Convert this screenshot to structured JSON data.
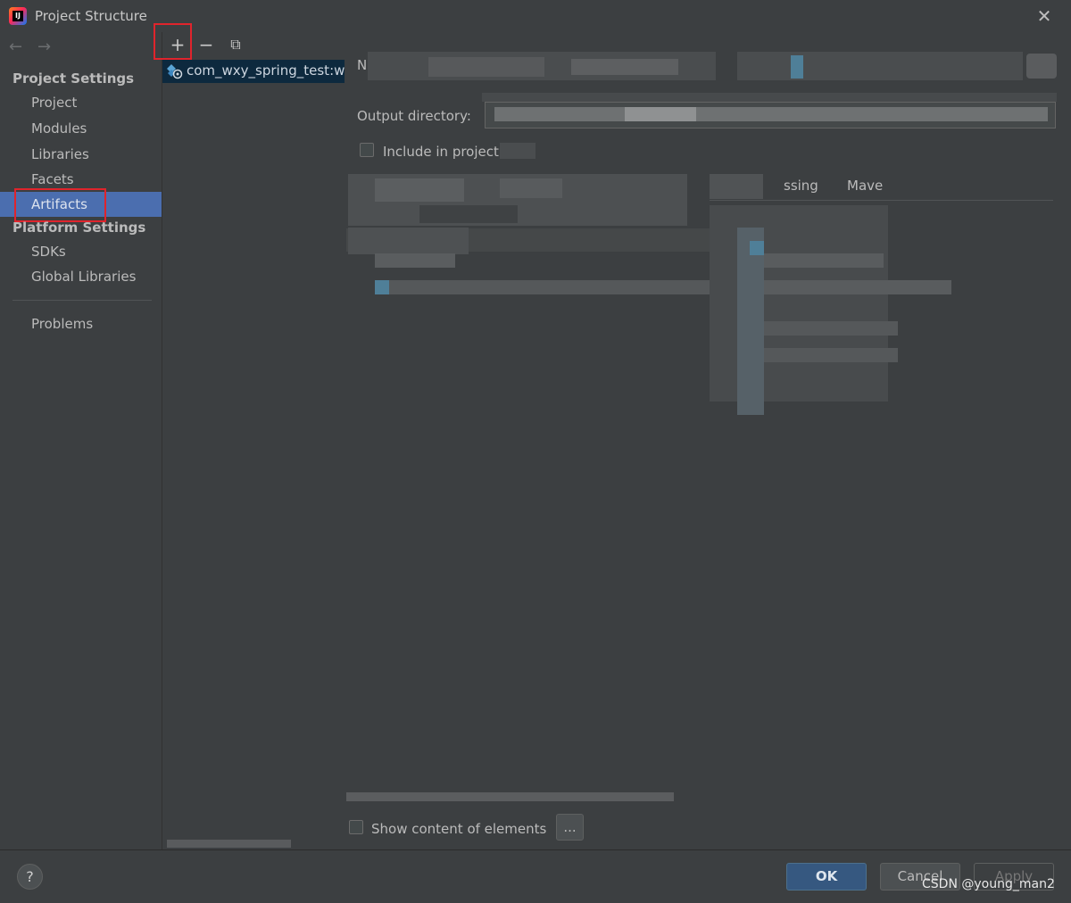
{
  "window": {
    "title": "Project Structure",
    "close_glyph": "✕",
    "logo_text": "IJ"
  },
  "nav": {
    "back_glyph": "←",
    "forward_glyph": "→"
  },
  "sidebar": {
    "project_settings_header": "Project Settings",
    "project_items": [
      "Project",
      "Modules",
      "Libraries",
      "Facets",
      "Artifacts"
    ],
    "active_item": "Artifacts",
    "platform_settings_header": "Platform Settings",
    "platform_items": [
      "SDKs",
      "Global Libraries"
    ],
    "problems": "Problems"
  },
  "toolbar": {
    "add_glyph": "+",
    "remove_glyph": "−",
    "copy_glyph": "⧉"
  },
  "artifact_list": {
    "items": [
      "com_wxy_spring_test:wa"
    ]
  },
  "details": {
    "name_label": "N",
    "output_directory_label": "Output directory:",
    "include_label": "Include in project",
    "tab_processing": "ssing",
    "tab_maven": "Mave"
  },
  "footer": {
    "show_content_label": "Show content of elements",
    "dots_label": "...",
    "help_glyph": "?",
    "ok_label": "OK",
    "cancel_label": "Cancel",
    "apply_label": "Apply",
    "watermark": "CSDN @young_man2"
  },
  "colors": {
    "background": "#3c3f41",
    "selection": "#4b6eaf",
    "artifact_selection": "#0d293e",
    "ok_button": "#365880",
    "annotation_red": "#e0242c"
  }
}
